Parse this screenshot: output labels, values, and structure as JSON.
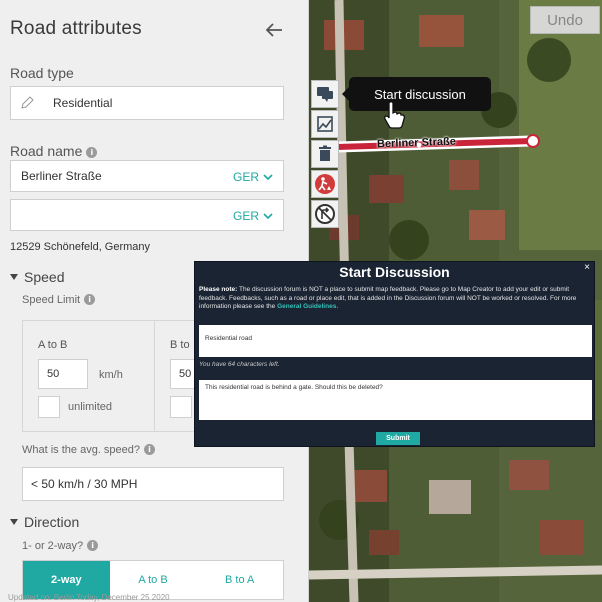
{
  "panel": {
    "title": "Road attributes",
    "road_type": {
      "label": "Road type",
      "value": "Residential"
    },
    "road_name": {
      "label": "Road name",
      "value": "Berliner Straße",
      "lang": "GER",
      "second_lang": "GER"
    },
    "address": "12529 Schönefeld, Germany",
    "speed": {
      "header": "Speed",
      "limit_label": "Speed Limit",
      "a_to_b": {
        "title": "A to B",
        "value": "50",
        "unit": "km/h",
        "unlimited": "unlimited"
      },
      "b_to_a": {
        "title": "B to",
        "value": "50"
      },
      "avg_question": "What is the avg. speed?",
      "avg_value": "< 50 km/h / 30 MPH"
    },
    "direction": {
      "header": "Direction",
      "question": "1- or 2-way?",
      "options": [
        "2-way",
        "A to B",
        "B to A"
      ],
      "selected": "2-way"
    },
    "footer": "Updated on: Berlin Today, December 25 2020"
  },
  "map": {
    "undo_label": "Undo",
    "tooltip": "Start discussion",
    "road_label": "Berliner Straße",
    "tools": [
      "discussion-icon",
      "report-image-icon",
      "trash-icon",
      "road-work-icon",
      "no-turn-icon"
    ]
  },
  "modal": {
    "title": "Start Discussion",
    "close": "×",
    "note_bold": "Please note:",
    "note_text": " The discussion forum is NOT a place to submit map feedback. Please go to Map Creator to add your edit or submit feedback. Feedbacks, such as a road or place edit, that is added in the Discussion forum will NOT be worked or resolved. For more information please see the ",
    "note_link": "General Guidelines",
    "title_value": "Residential road",
    "chars_left": "You have 64 characters left.",
    "body_value": "This residential road is behind a gate. Should this be deleted?",
    "submit": "Submit"
  }
}
